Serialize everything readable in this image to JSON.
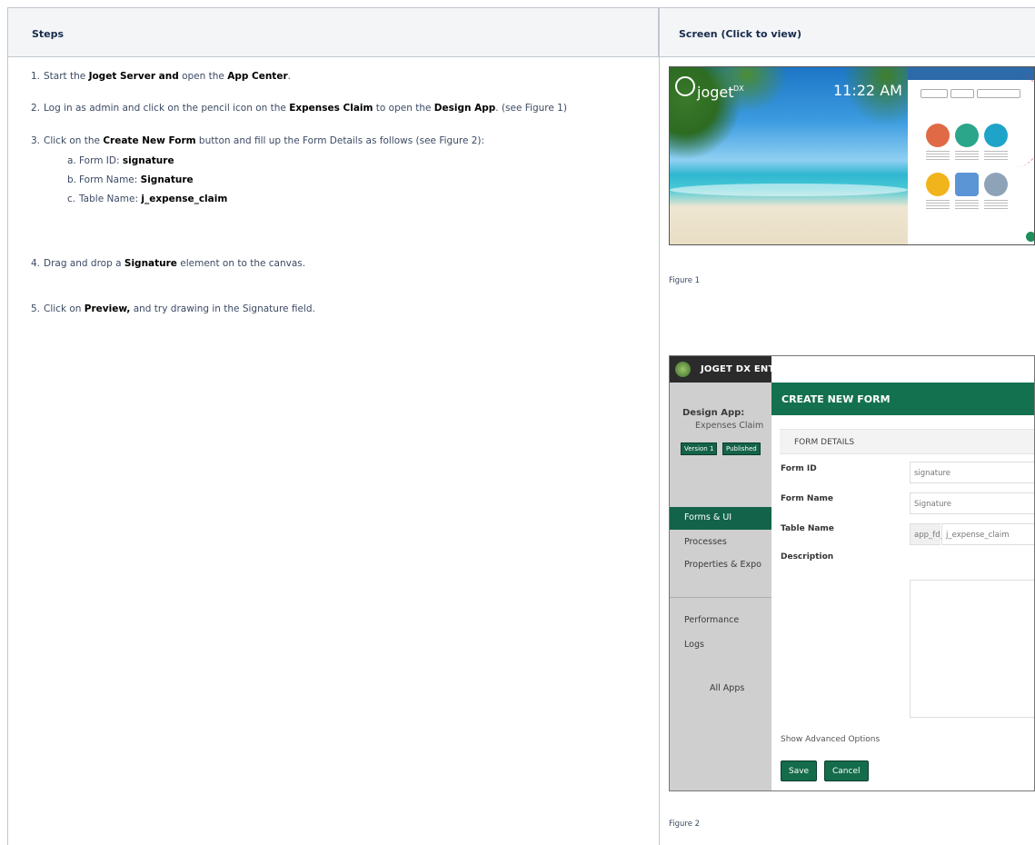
{
  "table": {
    "col_steps": "Steps",
    "col_screen": "Screen (Click to view)"
  },
  "steps": [
    {
      "num": "1.",
      "t1": "Start the ",
      "b1": "Joget Server and",
      "t2": " open the ",
      "b2": " App Center",
      "t3": "."
    },
    {
      "num": "2.",
      "t1": "Log in as admin and click on the pencil icon on the ",
      "b1": " Expenses Claim",
      "t2": " to open the ",
      "b2": "Design App",
      "t3": ". (see Figure 1)"
    },
    {
      "num": "3.",
      "t1": "Click on the ",
      "b1": " Create New Form",
      "t2": "  button and fill up the Form Details as follows (see Figure 2):"
    },
    {
      "num": "4.",
      "t1": "Drag and drop a ",
      "b1": "Signature",
      "t2": " element on to the canvas."
    },
    {
      "num": "5.",
      "t1": "Click on ",
      "b1": "Preview,",
      "t2": " and try drawing in the Signature field."
    }
  ],
  "substeps": [
    {
      "num": "a.",
      "t1": "Form ID: ",
      "b1": "signature"
    },
    {
      "num": "b.",
      "t1": "Form Name: ",
      "b1": " Signature"
    },
    {
      "num": "c.",
      "t1": "Table Name: ",
      "b1": "j_expense_claim"
    }
  ],
  "figure1": {
    "brand": "joget",
    "brand_suffix": "DX",
    "clock": "11:22 AM",
    "caption": "Figure 1"
  },
  "figure2": {
    "brand": "JOGET DX ENTERPRISE",
    "design_app": "Design App:",
    "app_name": "Expenses Claim",
    "version_badge": "Version 1",
    "published_badge": "Published",
    "nav": [
      "Forms & UI",
      "Processes",
      "Properties & Expo",
      "Performance",
      "Logs",
      "All Apps"
    ],
    "modal_title": "CREATE NEW FORM",
    "section": "FORM DETAILS",
    "labels": {
      "form_id": "Form ID",
      "form_name": "Form Name",
      "table_name": "Table Name",
      "description": "Description"
    },
    "values": {
      "form_id": "signature",
      "form_name": "Signature",
      "table_prefix": "app_fd_",
      "table_name": "j_expense_claim"
    },
    "advanced": "Show Advanced Options",
    "save": "Save",
    "cancel": "Cancel",
    "caption": "Figure 2"
  },
  "colors": {
    "accent": "#14714f",
    "header_bg": "#f4f5f7",
    "border": "#c1c7d0"
  }
}
